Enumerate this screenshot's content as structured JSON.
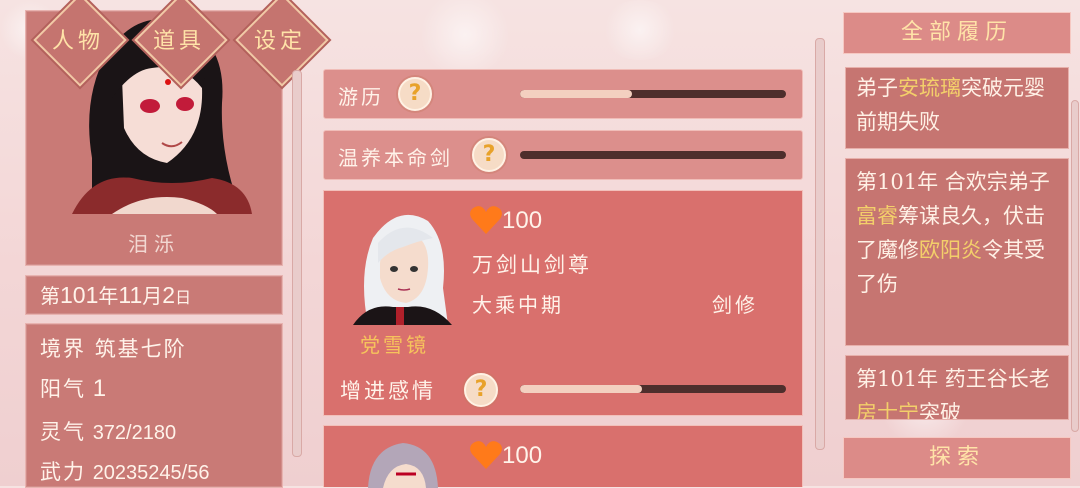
{
  "tabs": [
    {
      "label": "人物"
    },
    {
      "label": "道具"
    },
    {
      "label": "设定"
    }
  ],
  "character": {
    "name": "泪泺"
  },
  "date": {
    "prefix": "第",
    "year": "101",
    "y": "年",
    "month": "11",
    "m": "月",
    "day": "2",
    "d": "日"
  },
  "stats": {
    "realm_label": "境界",
    "realm_value": "筑基七阶",
    "yang_label": "阳气",
    "yang_value": "1",
    "spirit_label": "灵气",
    "spirit_value": "372/2180",
    "force_label": "武力",
    "force_value": "20235245/56"
  },
  "actions": [
    {
      "label": "游历",
      "progress": 0.42
    },
    {
      "label": "温养本命剑",
      "progress": 0.0
    }
  ],
  "npcs": [
    {
      "affection": "100",
      "title": "万剑山剑尊",
      "realm": "大乘中期",
      "relation": "剑修",
      "name": "党雪镜",
      "action_label": "增进感情",
      "progress": 0.46
    },
    {
      "affection": "100"
    }
  ],
  "history": {
    "title": "全部履历",
    "entries": [
      {
        "parts": [
          {
            "t": "弟子"
          },
          {
            "t": "安琉璃",
            "hl": true
          },
          {
            "t": "突破元婴前期失败"
          }
        ]
      },
      {
        "parts": [
          {
            "t": "第101年 合欢宗弟子"
          },
          {
            "t": "富睿",
            "hl": true
          },
          {
            "t": "筹谋良久，伏击了魔修"
          },
          {
            "t": "欧阳炎",
            "hl": true
          },
          {
            "t": "令其受了伤"
          }
        ]
      },
      {
        "parts": [
          {
            "t": "第101年 药王谷长老"
          },
          {
            "t": "房士宁",
            "hl": true
          },
          {
            "t": "突破"
          }
        ]
      }
    ]
  },
  "explore_label": "探索",
  "colors": {
    "panel": "#c97a76",
    "card": "#d9706d",
    "highlight": "#f3cf6a",
    "heart": "#ff7a1a"
  }
}
